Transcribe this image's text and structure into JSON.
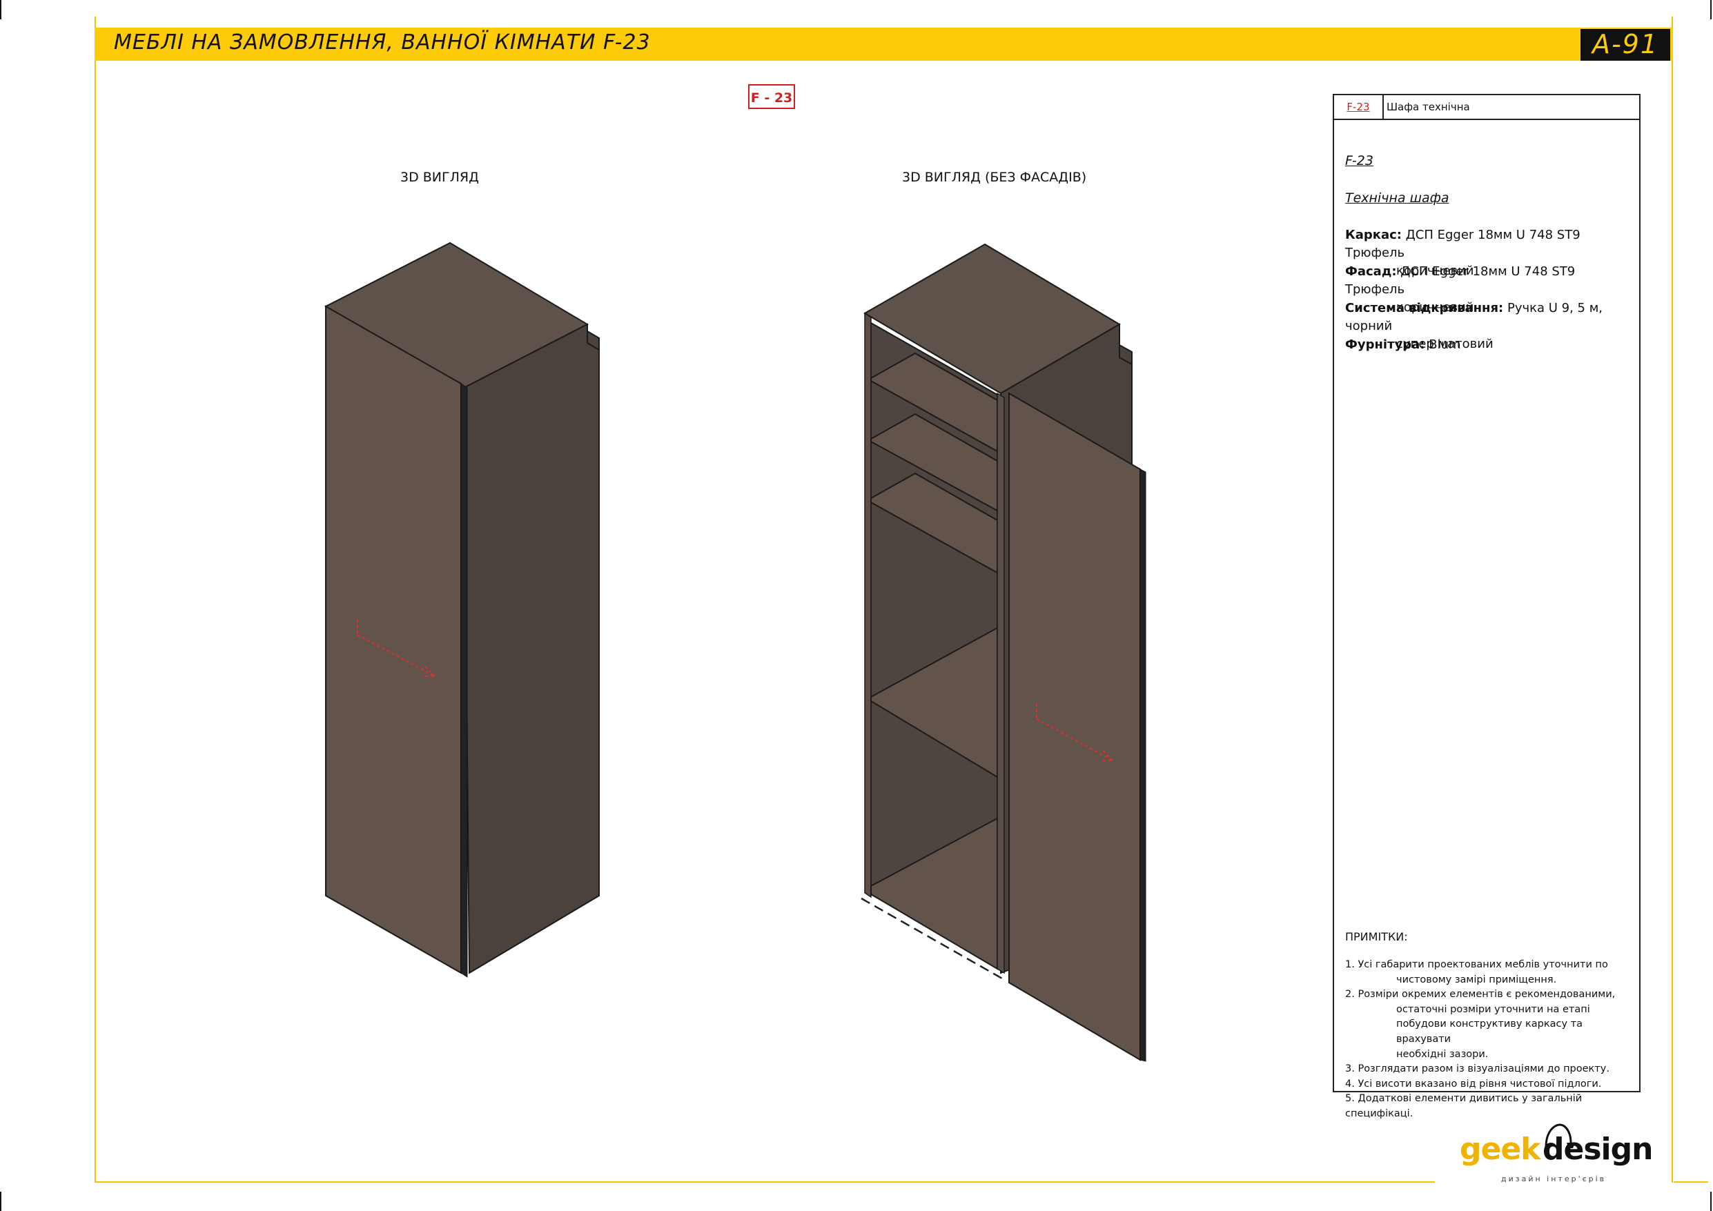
{
  "header": {
    "title": "МЕБЛІ НА ЗАМОВЛЕННЯ, ВАННОЇ КІМНАТИ F-23",
    "sheet_code": "A-91"
  },
  "badge": "F - 23",
  "views": {
    "left_label": "3D ВИГЛЯД",
    "right_label": "3D ВИГЛЯД (БЕЗ ФАСАДІВ)"
  },
  "spec": {
    "header_code": "F-23",
    "header_name": "Шафа технічна",
    "code": "F-23",
    "name": "Технічна шафа",
    "rows": [
      {
        "key": "Каркас:",
        "value": "ДСП Egger 18мм  U 748 ST9 Трюфель",
        "cont": "коричневий"
      },
      {
        "key": "Фасад:",
        "value": "ДСП Egger 18мм  U 748 ST9 Трюфель",
        "cont": "коричневий"
      },
      {
        "key": "Система відкривання:",
        "value": "Ручка U 9, 5 м, чорний",
        "cont": "супер матовий"
      },
      {
        "key": "Фурнітура:",
        "value": "Blum",
        "cont": ""
      }
    ],
    "notes_title": "ПРИМІТКИ:",
    "notes": [
      {
        "line": "1. Усі габарити проектованих меблів уточнити по",
        "cont": [
          "чистовому замірі приміщення."
        ]
      },
      {
        "line": "2. Розміри окремих елементів є рекомендованими,",
        "cont": [
          "остаточні розміри уточнити на етапі",
          "побудови конструктиву каркасу та врахувати",
          "необхідні зазори."
        ]
      },
      {
        "line": "3. Розглядати разом із візуалізаціями до проекту.",
        "cont": []
      },
      {
        "line": "4. Усі висоти вказано від рівня чистової підлоги.",
        "cont": []
      },
      {
        "line": "5. Додаткові елементи дивитись у загальній специфікаці.",
        "cont": []
      }
    ]
  },
  "logo": {
    "part1": "geek",
    "part2": "design",
    "tagline": "дизайн інтер'єрів"
  },
  "colors": {
    "accent_yellow": "#fdcb08",
    "cabinet_front": "#62544b",
    "cabinet_side": "#4c423c",
    "cabinet_top": "#5e524a",
    "handle_red": "#e03030"
  }
}
